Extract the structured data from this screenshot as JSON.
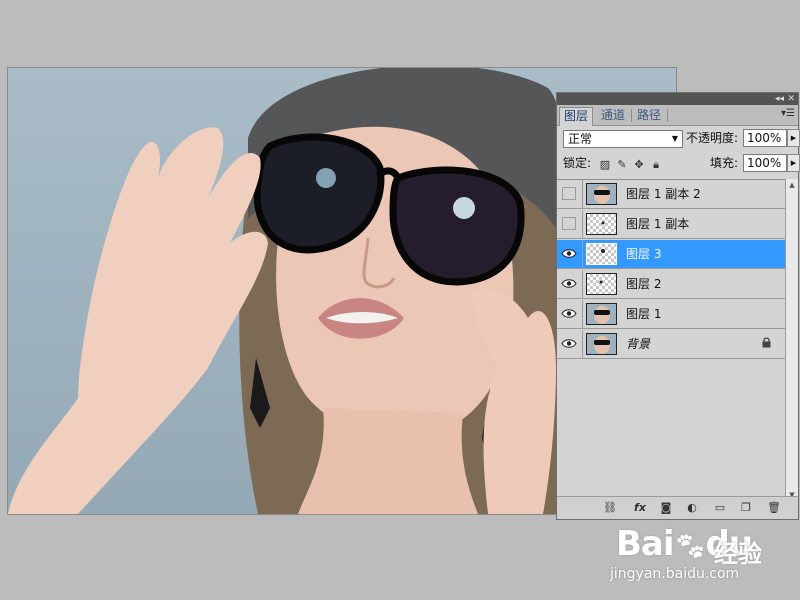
{
  "canvas": {
    "description_icon": "photo-canvas"
  },
  "layers_panel": {
    "tabs": [
      {
        "label": "图层",
        "active": true
      },
      {
        "label": "通道",
        "active": false
      },
      {
        "label": "路径",
        "active": false
      }
    ],
    "blend_mode": "正常",
    "opacity_label": "不透明度:",
    "opacity_value": "100%",
    "lock_label": "锁定:",
    "fill_label": "填充:",
    "fill_value": "100%",
    "layers": [
      {
        "name": "图层 1 副本 2",
        "visible": false,
        "selected": false,
        "thumb": "photo",
        "locked": false
      },
      {
        "name": "图层 1 副本",
        "visible": false,
        "selected": false,
        "thumb": "transparent",
        "locked": false
      },
      {
        "name": "图层 3",
        "visible": true,
        "selected": true,
        "thumb": "transparent",
        "locked": false
      },
      {
        "name": "图层 2",
        "visible": true,
        "selected": false,
        "thumb": "transparent",
        "locked": false
      },
      {
        "name": "图层 1",
        "visible": true,
        "selected": false,
        "thumb": "photo",
        "locked": false
      },
      {
        "name": "背景",
        "visible": true,
        "selected": false,
        "thumb": "photo",
        "locked": true
      }
    ],
    "footer_icons": [
      "link-icon",
      "fx-icon",
      "mask-icon",
      "adjustment-icon",
      "group-icon",
      "new-layer-icon",
      "trash-icon"
    ],
    "colors": {
      "selected": "#3399ff",
      "panel_bg": "#d4d4d4"
    }
  },
  "watermark": {
    "logo": "Bai",
    "logo_suffix": "du",
    "cn": "经验",
    "url": "jingyan.baidu.com"
  }
}
